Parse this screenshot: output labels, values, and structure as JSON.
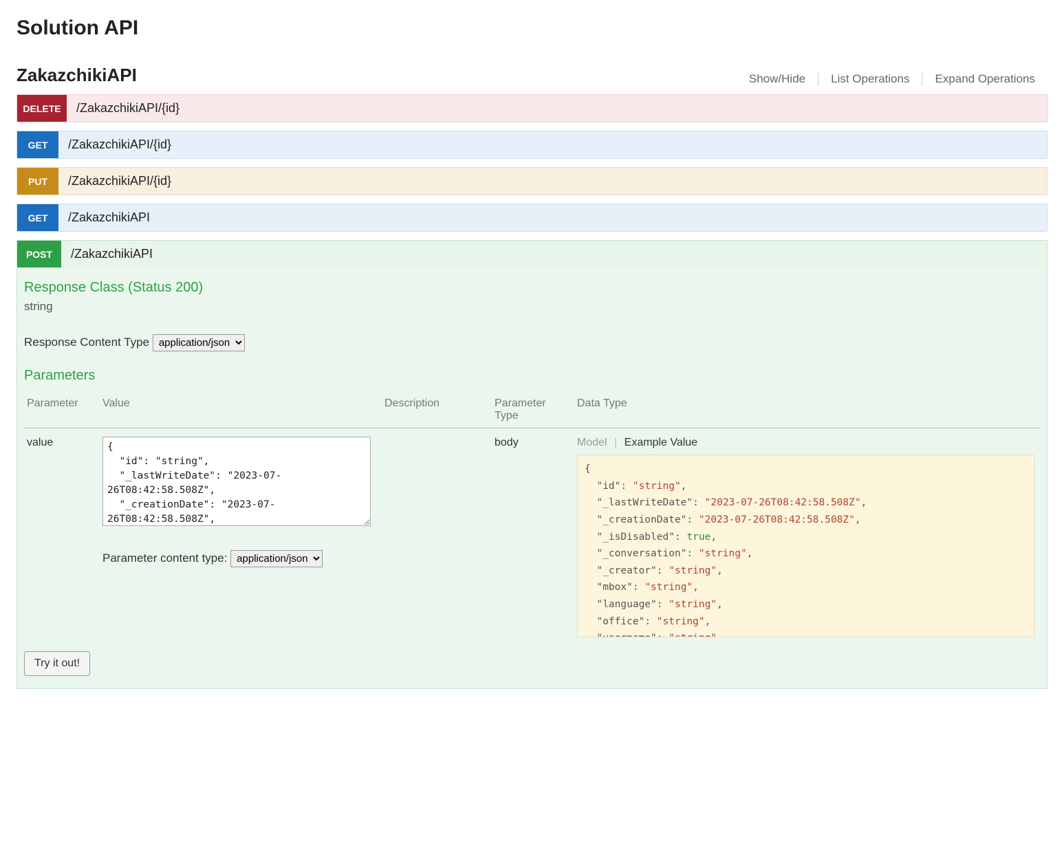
{
  "page_title": "Solution API",
  "api": {
    "name": "ZakazchikiAPI",
    "actions": {
      "show_hide": "Show/Hide",
      "list_ops": "List Operations",
      "expand_ops": "Expand Operations"
    }
  },
  "operations": [
    {
      "method": "DELETE",
      "path": "/ZakazchikiAPI/{id}",
      "cls": "delete"
    },
    {
      "method": "GET",
      "path": "/ZakazchikiAPI/{id}",
      "cls": "get"
    },
    {
      "method": "PUT",
      "path": "/ZakazchikiAPI/{id}",
      "cls": "put"
    },
    {
      "method": "GET",
      "path": "/ZakazchikiAPI",
      "cls": "get"
    },
    {
      "method": "POST",
      "path": "/ZakazchikiAPI",
      "cls": "post-closed"
    }
  ],
  "post_detail": {
    "response_class_title": "Response Class (Status 200)",
    "response_type": "string",
    "response_content_label": "Response Content Type",
    "response_content_value": "application/json",
    "parameters_title": "Parameters",
    "headers": {
      "parameter": "Parameter",
      "value": "Value",
      "description": "Description",
      "parameter_type": "Parameter Type",
      "data_type": "Data Type"
    },
    "row": {
      "parameter": "value",
      "value_text": "{\n  \"id\": \"string\",\n  \"_lastWriteDate\": \"2023-07-26T08:42:58.508Z\",\n  \"_creationDate\": \"2023-07-26T08:42:58.508Z\",\n  \"_isDisabled\": true,",
      "description": "",
      "parameter_type": "body"
    },
    "param_content_label": "Parameter content type:",
    "param_content_value": "application/json",
    "model_label": "Model",
    "example_label": "Example Value",
    "example_json": {
      "id": "string",
      "_lastWriteDate": "2023-07-26T08:42:58.508Z",
      "_creationDate": "2023-07-26T08:42:58.508Z",
      "_isDisabled": true,
      "_conversation": "string",
      "_creator": "string",
      "mbox": "string",
      "language": "string",
      "office": "string",
      "username": "string"
    },
    "try_button": "Try it out!"
  }
}
